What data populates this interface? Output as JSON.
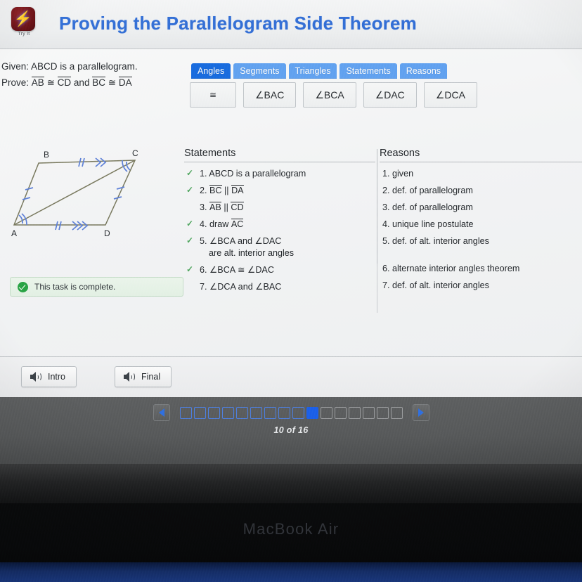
{
  "app": {
    "icon_name": "try-it-lightning-icon",
    "icon_label": "Try It",
    "title": "Proving the Parallelogram Side Theorem",
    "title_color": "#2f6bd4"
  },
  "problem": {
    "given_label": "Given:",
    "given_text": "ABCD is a parallelogram.",
    "prove_label": "Prove:",
    "prove_seg1": "AB",
    "prove_cong1": "≅",
    "prove_seg2": "CD",
    "prove_conj": "and",
    "prove_seg3": "BC",
    "prove_cong2": "≅",
    "prove_seg4": "DA"
  },
  "figure": {
    "name": "parallelogram-abcd-with-diagonal",
    "vertices": [
      "B",
      "C",
      "A",
      "D"
    ],
    "diagonal": "AC",
    "mark_color": "#5c7fd6",
    "outline_color": "#6b6b50"
  },
  "status": {
    "icon_name": "check-circle-icon",
    "message": "This task is complete.",
    "color": "#28a344"
  },
  "tabs": [
    {
      "label": "Angles",
      "active": true
    },
    {
      "label": "Segments",
      "active": false
    },
    {
      "label": "Triangles",
      "active": false
    },
    {
      "label": "Statements",
      "active": false
    },
    {
      "label": "Reasons",
      "active": false
    }
  ],
  "tab_colors": {
    "active": "#1668dd",
    "inactive": "#5fa0ef"
  },
  "chips": [
    {
      "label": "≅",
      "kind": "symbol"
    },
    {
      "label": "∠BAC",
      "kind": "angle"
    },
    {
      "label": "∠BCA",
      "kind": "angle"
    },
    {
      "label": "∠DAC",
      "kind": "angle"
    },
    {
      "label": "∠DCA",
      "kind": "angle"
    }
  ],
  "proof": {
    "statements_header": "Statements",
    "reasons_header": "Reasons",
    "statements": [
      {
        "num": "1.",
        "text": "ABCD is a parallelogram",
        "checked": true
      },
      {
        "num": "2.",
        "text": "BC || DA",
        "checked": true,
        "overline": [
          "BC",
          "DA"
        ]
      },
      {
        "num": "3.",
        "text": "AB || CD",
        "checked": false,
        "overline": [
          "AB",
          "CD"
        ]
      },
      {
        "num": "4.",
        "text": "draw AC",
        "checked": true,
        "overline": [
          "AC"
        ]
      },
      {
        "num": "5.",
        "text": "∠BCA and ∠DAC",
        "text2": "are alt. interior angles",
        "checked": true
      },
      {
        "num": "6.",
        "text": "∠BCA ≅ ∠DAC",
        "checked": true
      },
      {
        "num": "7.",
        "text": "∠DCA and ∠BAC",
        "checked": false
      }
    ],
    "reasons": [
      {
        "num": "1.",
        "text": "given"
      },
      {
        "num": "2.",
        "text": "def. of parallelogram"
      },
      {
        "num": "3.",
        "text": "def. of parallelogram"
      },
      {
        "num": "4.",
        "text": "unique line postulate"
      },
      {
        "num": "5.",
        "text": "def. of alt. interior angles"
      },
      {
        "num": "6.",
        "text": "alternate interior angles theorem"
      },
      {
        "num": "7.",
        "text": "def. of alt. interior angles"
      }
    ]
  },
  "audio": {
    "intro_label": "Intro",
    "final_label": "Final",
    "icon_name": "speaker-icon"
  },
  "pager": {
    "prev_icon": "chevron-left-icon",
    "next_icon": "chevron-right-icon",
    "total": 16,
    "current": 10,
    "label": "10 of 16",
    "visited_color": "#4d7fe0",
    "current_color": "#1b5fe8",
    "unvisited_color": "#9a9c9e"
  },
  "device": {
    "brand": "MacBook Air"
  }
}
